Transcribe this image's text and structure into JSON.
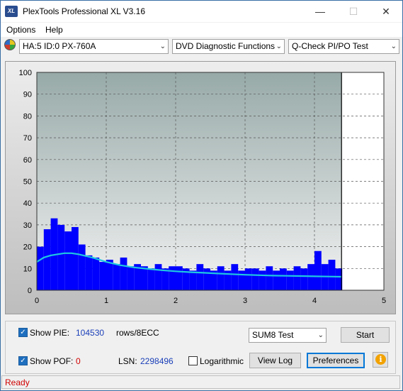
{
  "window": {
    "title": "PlexTools Professional XL V3.16",
    "icon_text": "XL",
    "controls": {
      "minimize": "—",
      "maximize": "☐",
      "close": "✕"
    }
  },
  "menu": {
    "items": [
      {
        "label": "Options"
      },
      {
        "label": "Help"
      }
    ]
  },
  "toolbar": {
    "drive_select": "HA:5 ID:0  PX-760A",
    "function_select": "DVD Diagnostic Functions",
    "test_select": "Q-Check PI/PO Test",
    "drive_icon": "disc-icon"
  },
  "chart_data": {
    "type": "bar",
    "title": "",
    "xlabel": "",
    "ylabel": "",
    "xlim": [
      0,
      5
    ],
    "ylim": [
      0,
      100
    ],
    "xticks": [
      "0",
      "1",
      "2",
      "3",
      "4",
      "5"
    ],
    "yticks": [
      "0",
      "10",
      "20",
      "30",
      "40",
      "50",
      "60",
      "70",
      "80",
      "90",
      "100"
    ],
    "grid": true,
    "data_end_x": 4.39,
    "colors": {
      "pie_bars": "#0000ff",
      "trend_line": "#1fc8e0",
      "plot_bg_top": "#97aaa8",
      "plot_bg_bottom": "#f2f2f2"
    },
    "series": [
      {
        "kind": "bars",
        "x": [
          0.0,
          0.1,
          0.2,
          0.3,
          0.4,
          0.5,
          0.6,
          0.7,
          0.8,
          0.9,
          1.0,
          1.1,
          1.2,
          1.3,
          1.4,
          1.5,
          1.6,
          1.7,
          1.8,
          1.9,
          2.0,
          2.1,
          2.2,
          2.3,
          2.4,
          2.5,
          2.6,
          2.7,
          2.8,
          2.9,
          3.0,
          3.1,
          3.2,
          3.3,
          3.4,
          3.5,
          3.6,
          3.7,
          3.8,
          3.9,
          4.0,
          4.1,
          4.2,
          4.3
        ],
        "values": [
          20,
          28,
          33,
          30,
          27,
          29,
          21,
          16,
          15,
          13,
          14,
          12,
          15,
          11,
          12,
          11,
          10,
          12,
          10,
          11,
          11,
          10,
          9,
          12,
          10,
          9,
          11,
          9,
          12,
          9,
          10,
          10,
          9,
          11,
          9,
          10,
          9,
          11,
          10,
          12,
          18,
          12,
          14,
          10
        ]
      },
      {
        "kind": "line",
        "x": [
          0.0,
          0.1,
          0.2,
          0.3,
          0.4,
          0.5,
          0.6,
          0.8,
          1.0,
          1.2,
          1.4,
          1.6,
          1.8,
          2.0,
          2.2,
          2.4,
          2.6,
          2.8,
          3.0,
          3.2,
          3.4,
          3.6,
          3.8,
          4.0,
          4.2,
          4.39
        ],
        "values": [
          13,
          15,
          16,
          16.5,
          17,
          17,
          16.5,
          15,
          13,
          11.5,
          10.5,
          9.8,
          9.2,
          8.7,
          8.3,
          8.0,
          7.7,
          7.4,
          7.1,
          6.9,
          6.7,
          6.6,
          6.5,
          6.4,
          6.3,
          6.2
        ]
      }
    ]
  },
  "controls": {
    "show_pie_label": "Show PIE:",
    "pie_value": "104530",
    "pie_unit": "rows/8ECC",
    "show_pof_label": "Show POF:",
    "pof_value": "0",
    "lsn_label": "LSN:",
    "lsn_value": "2298496",
    "logarithmic_label": "Logarithmic",
    "sum_select": "SUM8 Test",
    "start_label": "Start",
    "view_log_label": "View Log",
    "preferences_label": "Preferences",
    "info_icon": "info-icon",
    "show_pie_checked": true,
    "show_pof_checked": true,
    "logarithmic_checked": false
  },
  "status": {
    "text": "Ready"
  }
}
